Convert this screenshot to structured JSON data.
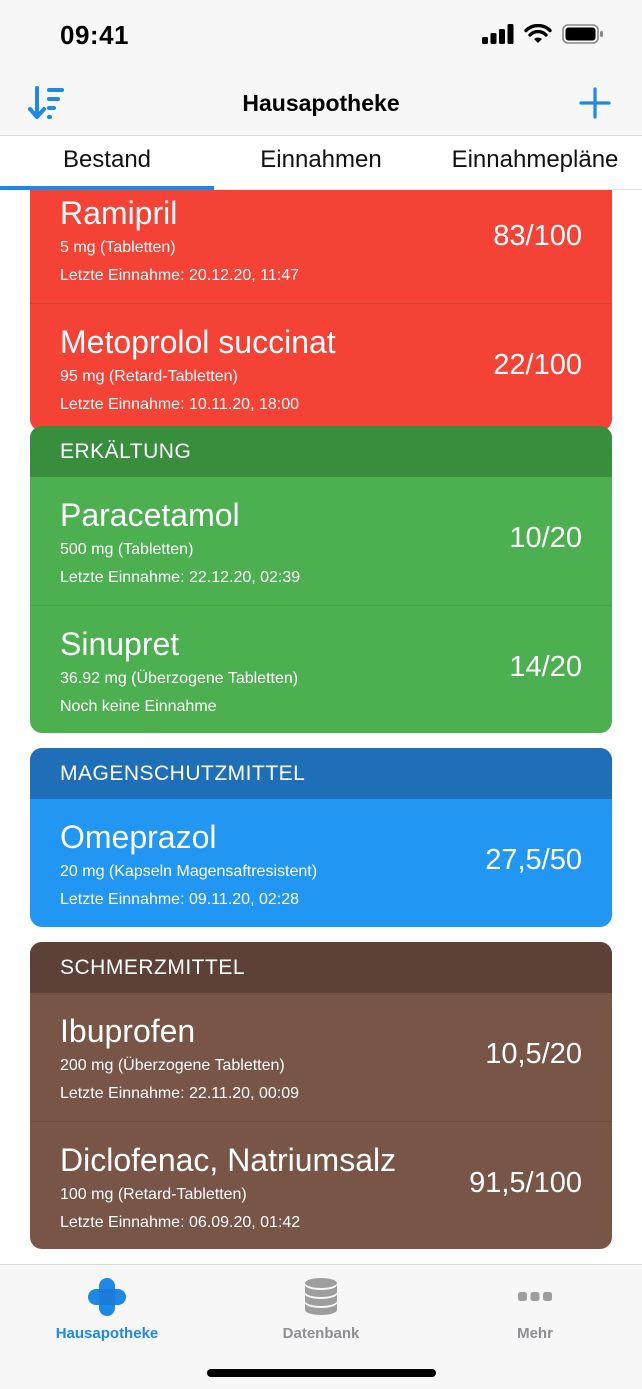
{
  "status_bar": {
    "time": "09:41"
  },
  "nav": {
    "title": "Hausapotheke",
    "sort_icon": "sort-descending-icon",
    "add_icon": "plus-icon"
  },
  "tabs": [
    {
      "label": "Bestand",
      "active": true
    },
    {
      "label": "Einnahmen",
      "active": false
    },
    {
      "label": "Einnahmepläne",
      "active": false
    }
  ],
  "groups": [
    {
      "title": "",
      "color": "#f44336",
      "header_color": "#c62828",
      "items": [
        {
          "name": "Ramipril",
          "dose": "5 mg (Tabletten)",
          "last_intake": "Letzte Einnahme: 20.12.20, 11:47",
          "stock": "83/100"
        },
        {
          "name": "Metoprolol succinat",
          "dose": "95 mg (Retard-Tabletten)",
          "last_intake": "Letzte Einnahme: 10.11.20, 18:00",
          "stock": "22/100"
        }
      ]
    },
    {
      "title": "ERKÄLTUNG",
      "color": "#4caf50",
      "header_color": "#388e3c",
      "items": [
        {
          "name": "Paracetamol",
          "dose": "500 mg (Tabletten)",
          "last_intake": "Letzte Einnahme: 22.12.20, 02:39",
          "stock": "10/20"
        },
        {
          "name": "Sinupret",
          "dose": "36.92 mg (Überzogene Tabletten)",
          "last_intake": "Noch keine Einnahme",
          "stock": "14/20"
        }
      ]
    },
    {
      "title": "MAGENSCHUTZMITTEL",
      "color": "#2196f3",
      "header_color": "#1e6fb7",
      "items": [
        {
          "name": "Omeprazol",
          "dose": "20 mg (Kapseln Magensaftresistent)",
          "last_intake": "Letzte Einnahme: 09.11.20, 02:28",
          "stock": "27,5/50"
        }
      ]
    },
    {
      "title": "SCHMERZMITTEL",
      "color": "#795548",
      "header_color": "#5d4037",
      "items": [
        {
          "name": "Ibuprofen",
          "dose": "200 mg (Überzogene Tabletten)",
          "last_intake": "Letzte Einnahme: 22.11.20, 00:09",
          "stock": "10,5/20"
        },
        {
          "name": "Diclofenac, Natriumsalz",
          "dose": "100 mg (Retard-Tabletten)",
          "last_intake": "Letzte Einnahme: 06.09.20, 01:42",
          "stock": "91,5/100"
        }
      ]
    }
  ],
  "bottom_tabs": [
    {
      "label": "Hausapotheke",
      "icon": "medical-cross-icon",
      "active": true
    },
    {
      "label": "Datenbank",
      "icon": "database-icon",
      "active": false
    },
    {
      "label": "Mehr",
      "icon": "more-dots-icon",
      "active": false
    }
  ],
  "colors": {
    "accent": "#1e88e5"
  }
}
